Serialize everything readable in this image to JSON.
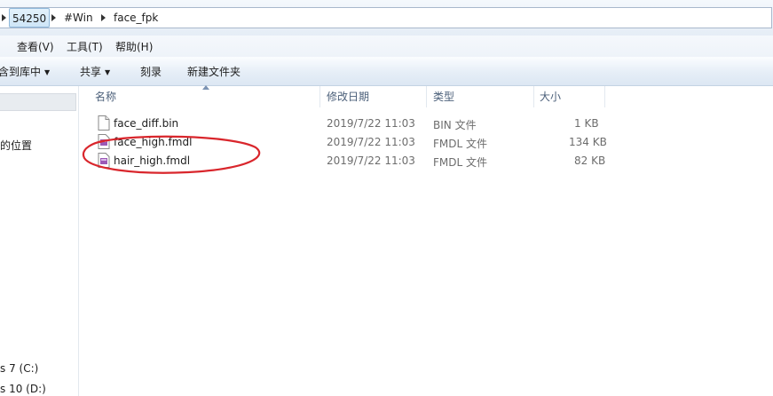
{
  "address": {
    "crumbs": [
      "54250",
      "#Win",
      "face_fpk"
    ]
  },
  "menu": [
    "查看(V)",
    "工具(T)",
    "帮助(H)"
  ],
  "menu_partial": "",
  "toolbar": {
    "include": "含到库中",
    "share": "共享",
    "burn": "刻录",
    "new_folder": "新建文件夹"
  },
  "nav": {
    "item1": "的位置",
    "drive1": "s 7 (C:)",
    "drive2": "s 10 (D:)"
  },
  "columns": {
    "name": "名称",
    "date": "修改日期",
    "type": "类型",
    "size": "大小"
  },
  "files": [
    {
      "name": "face_diff.bin",
      "date": "2019/7/22 11:03",
      "type": "BIN 文件",
      "size": "1 KB",
      "icon": "blank-file-icon"
    },
    {
      "name": "face_high.fmdl",
      "date": "2019/7/22 11:03",
      "type": "FMDL 文件",
      "size": "134 KB",
      "icon": "fmdl-file-icon"
    },
    {
      "name": "hair_high.fmdl",
      "date": "2019/7/22 11:03",
      "type": "FMDL 文件",
      "size": "82 KB",
      "icon": "fmdl-file-icon"
    }
  ],
  "annotation": {
    "color": "#d9262c",
    "shape": "red-ellipse"
  }
}
